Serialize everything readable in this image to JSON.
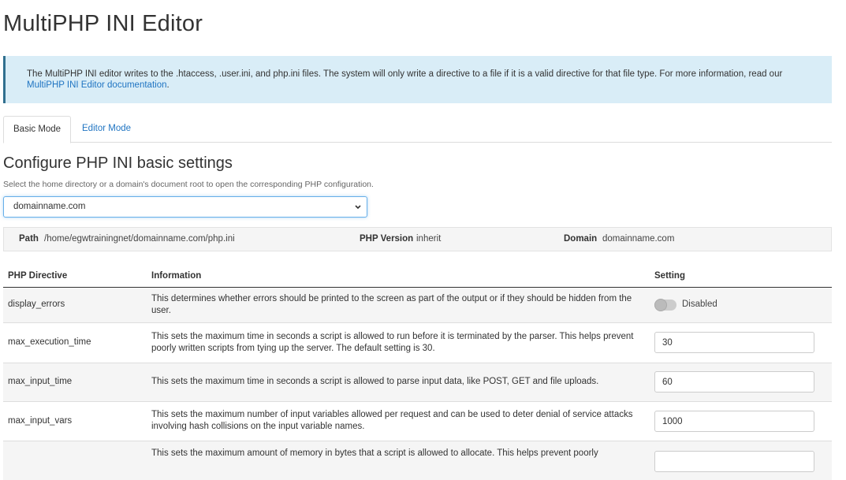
{
  "page": {
    "title": "MultiPHP INI Editor"
  },
  "alert": {
    "text": "The MultiPHP INI editor writes to the .htaccess, .user.ini, and php.ini files. The system will only write a directive to a file if it is a valid directive for that file type. For more information, read our ",
    "link_text": "MultiPHP INI Editor documentation",
    "suffix": "."
  },
  "tabs": [
    {
      "label": "Basic Mode",
      "active": true
    },
    {
      "label": "Editor Mode",
      "active": false
    }
  ],
  "section": {
    "title": "Configure PHP INI basic settings",
    "description": "Select the home directory or a domain's document root to open the corresponding PHP configuration."
  },
  "domain_select": {
    "selected": "domainname.com"
  },
  "infobar": {
    "path_label": "Path",
    "path_value": "/home/egwtrainingnet/domainname.com/php.ini",
    "version_label": "PHP Version",
    "version_value": "inherit",
    "domain_label": "Domain",
    "domain_value": "domainname.com"
  },
  "table": {
    "headers": [
      "PHP Directive",
      "Information",
      "Setting"
    ],
    "rows": [
      {
        "directive": "display_errors",
        "info": "This determines whether errors should be printed to the screen as part of the output or if they should be hidden from the user.",
        "type": "toggle",
        "value": "Disabled"
      },
      {
        "directive": "max_execution_time",
        "info": "This sets the maximum time in seconds a script is allowed to run before it is terminated by the parser. This helps prevent poorly written scripts from tying up the server. The default setting is 30.",
        "type": "input",
        "value": "30"
      },
      {
        "directive": "max_input_time",
        "info": "This sets the maximum time in seconds a script is allowed to parse input data, like POST, GET and file uploads.",
        "type": "input",
        "value": "60"
      },
      {
        "directive": "max_input_vars",
        "info": "This sets the maximum number of input variables allowed per request and can be used to deter denial of service attacks involving hash collisions on the input variable names.",
        "type": "input",
        "value": "1000"
      },
      {
        "directive": "",
        "info": "This sets the maximum amount of memory in bytes that a script is allowed to allocate. This helps prevent poorly",
        "type": "input",
        "value": ""
      }
    ]
  }
}
